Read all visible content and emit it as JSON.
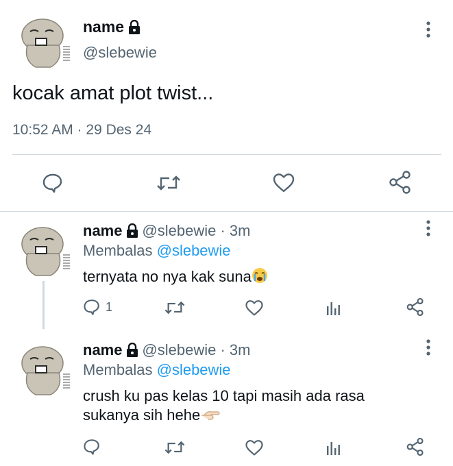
{
  "main_tweet": {
    "display_name": "name",
    "handle": "@slebewie",
    "text": "kocak amat plot twist...",
    "meta": "10:52 AM · 29 Des 24",
    "icons": [
      "reply-icon",
      "retweet-icon",
      "like-icon",
      "share-icon",
      "more-icon",
      "lock-icon"
    ]
  },
  "replies": [
    {
      "display_name": "name",
      "handle_time": "@slebewie · 3m",
      "replying_prefix": "Membalas",
      "replying_to": "@slebewie",
      "text": "ternyata no nya kak suna",
      "emoji": "crying-face-emoji",
      "reply_count": "1"
    },
    {
      "display_name": "name",
      "handle_time": "@slebewie · 3m",
      "replying_prefix": "Membalas",
      "replying_to": "@slebewie",
      "text_line1": "crush ku pas kelas 10 tapi masih ada rasa",
      "text_line2": "sukanya sih hehe",
      "emoji": "pointing-hand-emoji",
      "reply_count": ""
    }
  ],
  "colors": {
    "text": "#0f1419",
    "muted": "#536471",
    "link": "#1d9bf0",
    "divider": "#cfd9de"
  }
}
